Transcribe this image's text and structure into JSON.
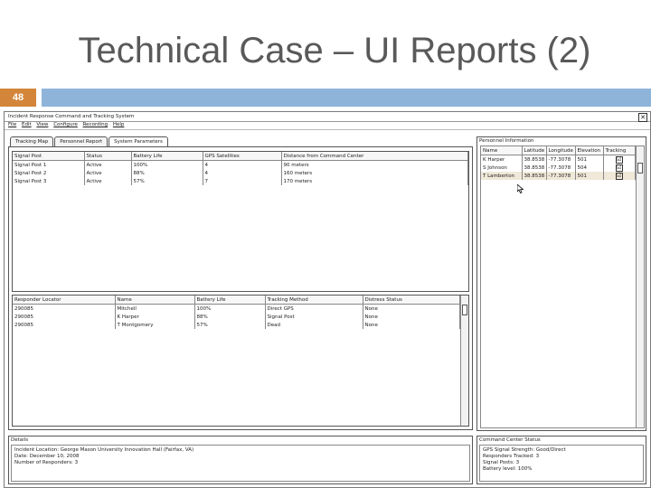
{
  "slide": {
    "title": "Technical Case – UI Reports (2)",
    "number": "48"
  },
  "window": {
    "title": "Incident Response Command and Tracking System",
    "close_glyph": "✕",
    "menu": [
      "File",
      "Edit",
      "View",
      "Configure",
      "Recording",
      "Help"
    ],
    "tabs": [
      "Tracking Map",
      "Personnel Report",
      "System Parameters"
    ],
    "active_tab": "System Parameters"
  },
  "signal_table": {
    "columns": [
      "Signal Post",
      "Status",
      "Battery Life",
      "GPS Satellites",
      "Distance from Command Center"
    ],
    "rows": [
      [
        "Signal Post 1",
        "Active",
        "100%",
        "4",
        "90 meters"
      ],
      [
        "Signal Post 2",
        "Active",
        "88%",
        "4",
        "160 meters"
      ],
      [
        "Signal Post 3",
        "Active",
        "57%",
        "7",
        "170 meters"
      ]
    ]
  },
  "responder_table": {
    "columns": [
      "Responder Locator",
      "Name",
      "Battery Life",
      "Tracking Method",
      "Distress Status"
    ],
    "rows": [
      [
        "290085",
        "Mitchell",
        "100%",
        "Direct GPS",
        "None"
      ],
      [
        "290085",
        "K Harper",
        "88%",
        "Signal Post",
        "None"
      ],
      [
        "290085",
        "T Montgomery",
        "57%",
        "Dead",
        "None"
      ]
    ]
  },
  "personnel_panel": {
    "title": "Personnel Information",
    "columns": [
      "Name",
      "Latitude",
      "Longitude",
      "Elevation",
      "Tracking"
    ],
    "rows": [
      {
        "name": "K Harper",
        "lat": "38.8538",
        "lon": "-77.3078",
        "elev": "501",
        "checked": true
      },
      {
        "name": "S Johnson",
        "lat": "38.8538",
        "lon": "-77.3078",
        "elev": "504",
        "checked": true
      },
      {
        "name": "T Lamberton",
        "lat": "38.8538",
        "lon": "-77.3078",
        "elev": "501",
        "checked": true
      }
    ],
    "check_glyph": "☑"
  },
  "details": {
    "title": "Details",
    "lines": [
      "Incident Location: George Mason University Innovation Hall (Fairfax, VA)",
      "Date: December 10, 2008",
      "Number of Responders: 3"
    ]
  },
  "command_center": {
    "title": "Command Center Status",
    "lines": [
      "GPS Signal Strength: Good/Direct",
      "Responders Tracked: 3",
      "Signal Posts: 3",
      "Battery level: 100%"
    ]
  }
}
